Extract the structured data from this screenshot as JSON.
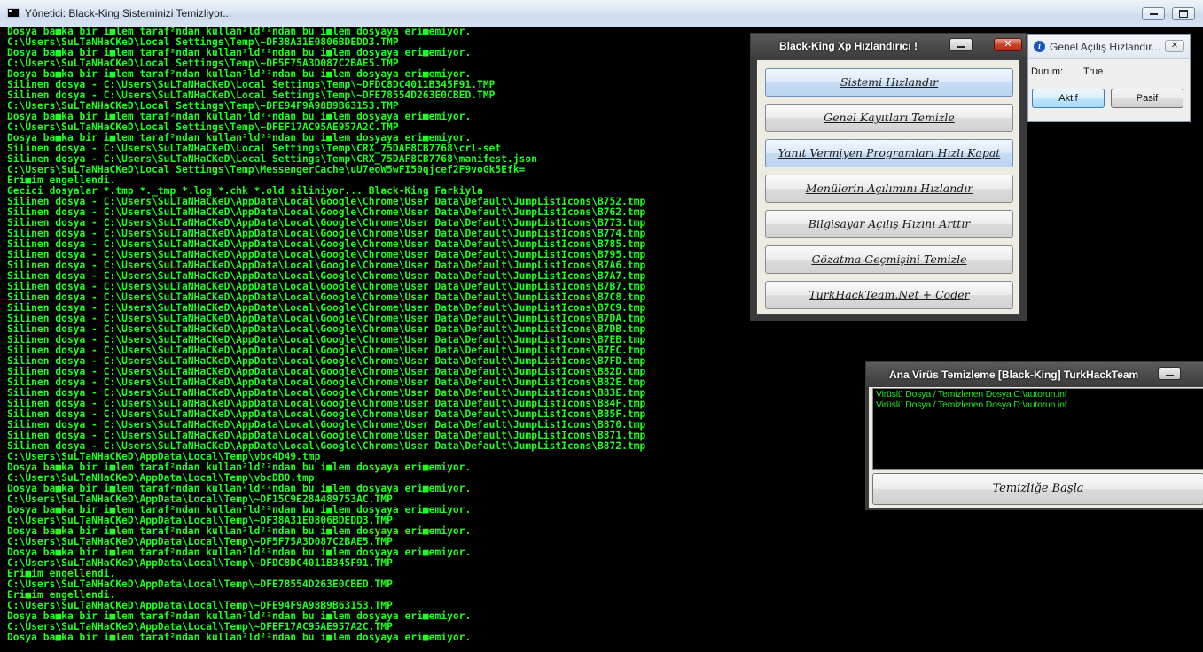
{
  "console": {
    "title": "Yönetici:  Black-King Sisteminizi Temizliyor...",
    "minimize": "▭",
    "maximize": "▢",
    "lines": [
      "Dosya ba■ka bir i■lem taraf²ndan kullan²ld²²ndan bu i■lem dosyaya eri■emiyor.",
      "C:\\Users\\SuLTaNHaCKeD\\Local Settings\\Temp\\~DF38A31E0806BDEDD3.TMP",
      "Dosya ba■ka bir i■lem taraf²ndan kullan²ld²²ndan bu i■lem dosyaya eri■emiyor.",
      "C:\\Users\\SuLTaNHaCKeD\\Local Settings\\Temp\\~DF5F75A3D087C2BAE5.TMP",
      "Dosya ba■ka bir i■lem taraf²ndan kullan²ld²²ndan bu i■lem dosyaya eri■emiyor.",
      "Silinen dosya - C:\\Users\\SuLTaNHaCKeD\\Local Settings\\Temp\\~DFDC8DC4011B345F91.TMP",
      "Silinen dosya - C:\\Users\\SuLTaNHaCKeD\\Local Settings\\Temp\\~DFE78554D263E0CBED.TMP",
      "C:\\Users\\SuLTaNHaCKeD\\Local Settings\\Temp\\~DFE94F9A98B9B63153.TMP",
      "Dosya ba■ka bir i■lem taraf²ndan kullan²ld²²ndan bu i■lem dosyaya eri■emiyor.",
      "C:\\Users\\SuLTaNHaCKeD\\Local Settings\\Temp\\~DFEF17AC95AE957A2C.TMP",
      "Dosya ba■ka bir i■lem taraf²ndan kullan²ld²²ndan bu i■lem dosyaya eri■emiyor.",
      "Silinen dosya - C:\\Users\\SuLTaNHaCKeD\\Local Settings\\Temp\\CRX_75DAF8CB7768\\crl-set",
      "Silinen dosya - C:\\Users\\SuLTaNHaCKeD\\Local Settings\\Temp\\CRX_75DAF8CB7768\\manifest.json",
      "C:\\Users\\SuLTaNHaCKeD\\Local Settings\\Temp\\MessengerCache\\uU7eoW5wFI50qjcef2F9voGk5Efk=",
      "Eri■im engellendi.",
      "Gecici dosyalar *.tmp *._tmp *.log *.chk *.old siliniyor... Black-King Farkiyla",
      "Silinen dosya - C:\\Users\\SuLTaNHaCKeD\\AppData\\Local\\Google\\Chrome\\User Data\\Default\\JumpListIcons\\B752.tmp",
      "Silinen dosya - C:\\Users\\SuLTaNHaCKeD\\AppData\\Local\\Google\\Chrome\\User Data\\Default\\JumpListIcons\\B762.tmp",
      "Silinen dosya - C:\\Users\\SuLTaNHaCKeD\\AppData\\Local\\Google\\Chrome\\User Data\\Default\\JumpListIcons\\B773.tmp",
      "Silinen dosya - C:\\Users\\SuLTaNHaCKeD\\AppData\\Local\\Google\\Chrome\\User Data\\Default\\JumpListIcons\\B774.tmp",
      "Silinen dosya - C:\\Users\\SuLTaNHaCKeD\\AppData\\Local\\Google\\Chrome\\User Data\\Default\\JumpListIcons\\B785.tmp",
      "Silinen dosya - C:\\Users\\SuLTaNHaCKeD\\AppData\\Local\\Google\\Chrome\\User Data\\Default\\JumpListIcons\\B795.tmp",
      "Silinen dosya - C:\\Users\\SuLTaNHaCKeD\\AppData\\Local\\Google\\Chrome\\User Data\\Default\\JumpListIcons\\B7A6.tmp",
      "Silinen dosya - C:\\Users\\SuLTaNHaCKeD\\AppData\\Local\\Google\\Chrome\\User Data\\Default\\JumpListIcons\\B7A7.tmp",
      "Silinen dosya - C:\\Users\\SuLTaNHaCKeD\\AppData\\Local\\Google\\Chrome\\User Data\\Default\\JumpListIcons\\B7B7.tmp",
      "Silinen dosya - C:\\Users\\SuLTaNHaCKeD\\AppData\\Local\\Google\\Chrome\\User Data\\Default\\JumpListIcons\\B7C8.tmp",
      "Silinen dosya - C:\\Users\\SuLTaNHaCKeD\\AppData\\Local\\Google\\Chrome\\User Data\\Default\\JumpListIcons\\B7C9.tmp",
      "Silinen dosya - C:\\Users\\SuLTaNHaCKeD\\AppData\\Local\\Google\\Chrome\\User Data\\Default\\JumpListIcons\\B7DA.tmp",
      "Silinen dosya - C:\\Users\\SuLTaNHaCKeD\\AppData\\Local\\Google\\Chrome\\User Data\\Default\\JumpListIcons\\B7DB.tmp",
      "Silinen dosya - C:\\Users\\SuLTaNHaCKeD\\AppData\\Local\\Google\\Chrome\\User Data\\Default\\JumpListIcons\\B7EB.tmp",
      "Silinen dosya - C:\\Users\\SuLTaNHaCKeD\\AppData\\Local\\Google\\Chrome\\User Data\\Default\\JumpListIcons\\B7EC.tmp",
      "Silinen dosya - C:\\Users\\SuLTaNHaCKeD\\AppData\\Local\\Google\\Chrome\\User Data\\Default\\JumpListIcons\\B7FD.tmp",
      "Silinen dosya - C:\\Users\\SuLTaNHaCKeD\\AppData\\Local\\Google\\Chrome\\User Data\\Default\\JumpListIcons\\B82D.tmp",
      "Silinen dosya - C:\\Users\\SuLTaNHaCKeD\\AppData\\Local\\Google\\Chrome\\User Data\\Default\\JumpListIcons\\B82E.tmp",
      "Silinen dosya - C:\\Users\\SuLTaNHaCKeD\\AppData\\Local\\Google\\Chrome\\User Data\\Default\\JumpListIcons\\B83E.tmp",
      "Silinen dosya - C:\\Users\\SuLTaNHaCKeD\\AppData\\Local\\Google\\Chrome\\User Data\\Default\\JumpListIcons\\B84F.tmp",
      "Silinen dosya - C:\\Users\\SuLTaNHaCKeD\\AppData\\Local\\Google\\Chrome\\User Data\\Default\\JumpListIcons\\B85F.tmp",
      "Silinen dosya - C:\\Users\\SuLTaNHaCKeD\\AppData\\Local\\Google\\Chrome\\User Data\\Default\\JumpListIcons\\B870.tmp",
      "Silinen dosya - C:\\Users\\SuLTaNHaCKeD\\AppData\\Local\\Google\\Chrome\\User Data\\Default\\JumpListIcons\\B871.tmp",
      "Silinen dosya - C:\\Users\\SuLTaNHaCKeD\\AppData\\Local\\Google\\Chrome\\User Data\\Default\\JumpListIcons\\B872.tmp",
      "C:\\Users\\SuLTaNHaCKeD\\AppData\\Local\\Temp\\vbc4D49.tmp",
      "Dosya ba■ka bir i■lem taraf²ndan kullan²ld²²ndan bu i■lem dosyaya eri■emiyor.",
      "C:\\Users\\SuLTaNHaCKeD\\AppData\\Local\\Temp\\vbcDB0.tmp",
      "Dosya ba■ka bir i■lem taraf²ndan kullan²ld²²ndan bu i■lem dosyaya eri■emiyor.",
      "C:\\Users\\SuLTaNHaCKeD\\AppData\\Local\\Temp\\~DF15C9E284489753AC.TMP",
      "Dosya ba■ka bir i■lem taraf²ndan kullan²ld²²ndan bu i■lem dosyaya eri■emiyor.",
      "C:\\Users\\SuLTaNHaCKeD\\AppData\\Local\\Temp\\~DF38A31E0806BDEDD3.TMP",
      "Dosya ba■ka bir i■lem taraf²ndan kullan²ld²²ndan bu i■lem dosyaya eri■emiyor.",
      "C:\\Users\\SuLTaNHaCKeD\\AppData\\Local\\Temp\\~DF5F75A3D087C2BAE5.TMP",
      "Dosya ba■ka bir i■lem taraf²ndan kullan²ld²²ndan bu i■lem dosyaya eri■emiyor.",
      "C:\\Users\\SuLTaNHaCKeD\\AppData\\Local\\Temp\\~DFDC8DC4011B345F91.TMP",
      "Eri■im engellendi.",
      "C:\\Users\\SuLTaNHaCKeD\\AppData\\Local\\Temp\\~DFE78554D263E0CBED.TMP",
      "Eri■im engellendi.",
      "C:\\Users\\SuLTaNHaCKeD\\AppData\\Local\\Temp\\~DFE94F9A98B9B63153.TMP",
      "Dosya ba■ka bir i■lem taraf²ndan kullan²ld²²ndan bu i■lem dosyaya eri■emiyor.",
      "C:\\Users\\SuLTaNHaCKeD\\AppData\\Local\\Temp\\~DFEF17AC95AE957A2C.TMP",
      "Dosya ba■ka bir i■lem taraf²ndan kullan²ld²²ndan bu i■lem dosyaya eri■emiyor."
    ]
  },
  "xp_window": {
    "title": "Black-King Xp Hızlandırıcı !",
    "close": "✕",
    "buttons": [
      "Sistemi Hızlandır",
      "Genel Kayıtları Temizle",
      "Yanıt Vermiyen Programları Hızlı Kapat",
      "Menülerin Açılımını Hızlandır",
      "Bilgisayar Açılış Hızını Arttır",
      "Gözatma Geçmişini Temizle",
      "TurkHackTeam.Net + Coder"
    ]
  },
  "boot_window": {
    "title": "Genel Açılış Hızlandır...",
    "close": "✕",
    "status_label": "Durum:",
    "status_value": "True",
    "active_button": "Aktif",
    "passive_button": "Pasif"
  },
  "virus_window": {
    "title": "Ana Virüs Temizleme [Black-King] TurkHackTeam",
    "log": [
      "Virüslü Dosya / Temizlenen Dosya C:\\autorun.inf",
      "Virüslü Dosya / Temizlenen Dosya D:\\autorun.inf"
    ],
    "start_button": "Temizliğe Başla"
  },
  "colors": {
    "console_text": "#1fff1f",
    "console_bg": "#000000",
    "dialog_frame": "#3a3a3a"
  }
}
